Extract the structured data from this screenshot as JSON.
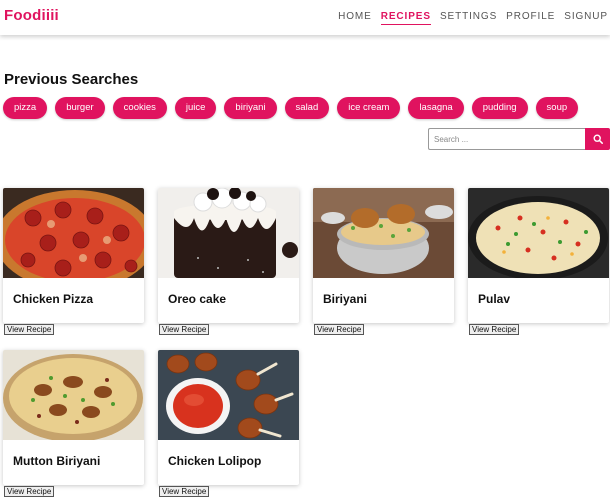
{
  "header": {
    "logo_part1": "Food",
    "logo_part2": "iiii",
    "nav": [
      "HOME",
      "RECIPES",
      "SETTINGS",
      "PROFILE",
      "SIGNUP"
    ],
    "active_nav": "RECIPES"
  },
  "searches": {
    "title": "Previous Searches",
    "chips": [
      "pizza",
      "burger",
      "cookies",
      "juice",
      "biriyani",
      "salad",
      "ice cream",
      "lasagna",
      "pudding",
      "soup"
    ]
  },
  "search": {
    "placeholder": "Search ...",
    "icon": "search-icon"
  },
  "recipes": [
    {
      "title": "Chicken Pizza",
      "button": "View Recipe"
    },
    {
      "title": "Oreo cake",
      "button": "View Recipe"
    },
    {
      "title": "Biriyani",
      "button": "View Recipe"
    },
    {
      "title": "Pulav",
      "button": "View Recipe"
    },
    {
      "title": "Mutton Biriyani",
      "button": "View Recipe"
    },
    {
      "title": "Chicken Lolipop",
      "button": "View Recipe"
    }
  ],
  "colors": {
    "accent": "#e0135f"
  }
}
